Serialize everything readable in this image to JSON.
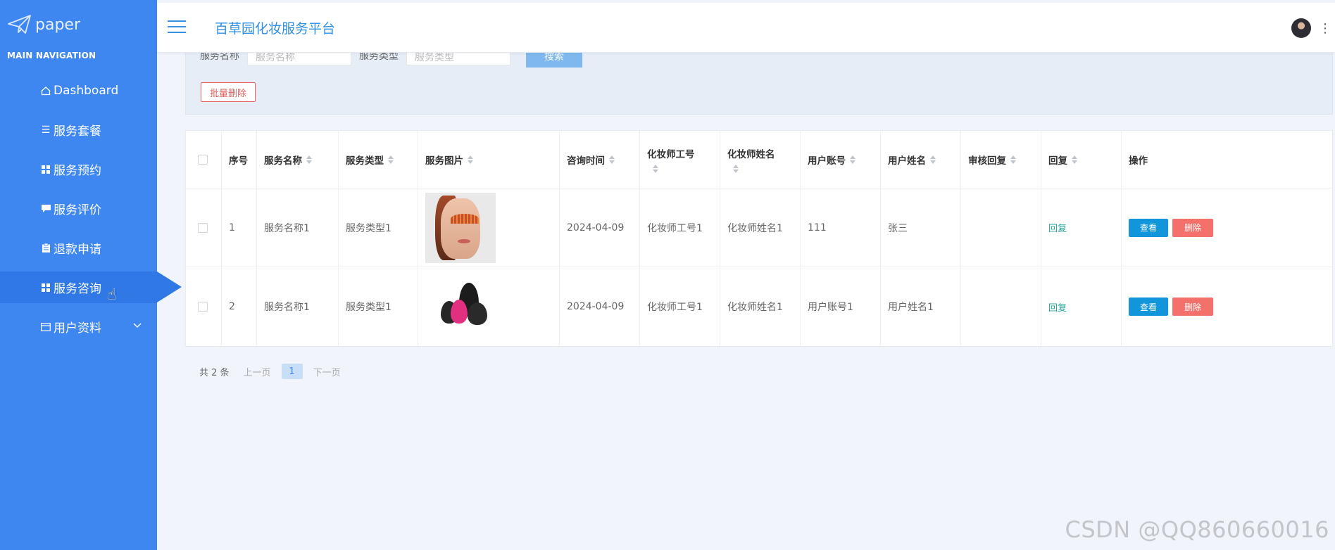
{
  "sidebar": {
    "logo_text": "paper",
    "section_title": "MAIN NAVIGATION",
    "items": [
      {
        "label": "Dashboard",
        "icon": "home-icon"
      },
      {
        "label": "服务套餐",
        "icon": "list-icon"
      },
      {
        "label": "服务预约",
        "icon": "grid-icon"
      },
      {
        "label": "服务评价",
        "icon": "comment-icon"
      },
      {
        "label": "退款申请",
        "icon": "clipboard-icon"
      },
      {
        "label": "服务咨询",
        "icon": "grid-icon",
        "active": true
      },
      {
        "label": "用户资料",
        "icon": "card-icon",
        "expandable": true
      }
    ]
  },
  "header": {
    "title": "百草园化妆服务平台"
  },
  "search": {
    "label_name": "服务名称",
    "placeholder_name": "服务名称",
    "label_type": "服务类型",
    "placeholder_type": "服务类型",
    "search_button": "搜索",
    "batch_delete": "批量删除"
  },
  "table": {
    "headers": [
      "序号",
      "服务名称",
      "服务类型",
      "服务图片",
      "咨询时间",
      "化妆师工号",
      "化妆师姓名",
      "用户账号",
      "用户姓名",
      "审核回复",
      "回复",
      "操作"
    ],
    "rows": [
      {
        "index": "1",
        "service_name": "服务名称1",
        "service_type": "服务类型1",
        "image": "makeup-model-photo",
        "consult_time": "2024-04-09",
        "artist_id": "化妆师工号1",
        "artist_name": "化妆师姓名1",
        "user_account": "111",
        "user_name": "张三",
        "review_reply": "",
        "reply": "回复",
        "view": "查看",
        "delete": "删除"
      },
      {
        "index": "2",
        "service_name": "服务名称1",
        "service_type": "服务类型1",
        "image": "makeup-sponges-photo",
        "consult_time": "2024-04-09",
        "artist_id": "化妆师工号1",
        "artist_name": "化妆师姓名1",
        "user_account": "用户账号1",
        "user_name": "用户姓名1",
        "review_reply": "",
        "reply": "回复",
        "view": "查看",
        "delete": "删除"
      }
    ]
  },
  "pagination": {
    "total": "共 2 条",
    "prev": "上一页",
    "current": "1",
    "next": "下一页"
  },
  "watermark": "CSDN @QQ860660016",
  "colors": {
    "sidebar": "#3f87f0",
    "accent": "#2f8fe0",
    "danger": "#f3706b",
    "primary_button": "#1296db",
    "reply_link": "#26a69a"
  }
}
